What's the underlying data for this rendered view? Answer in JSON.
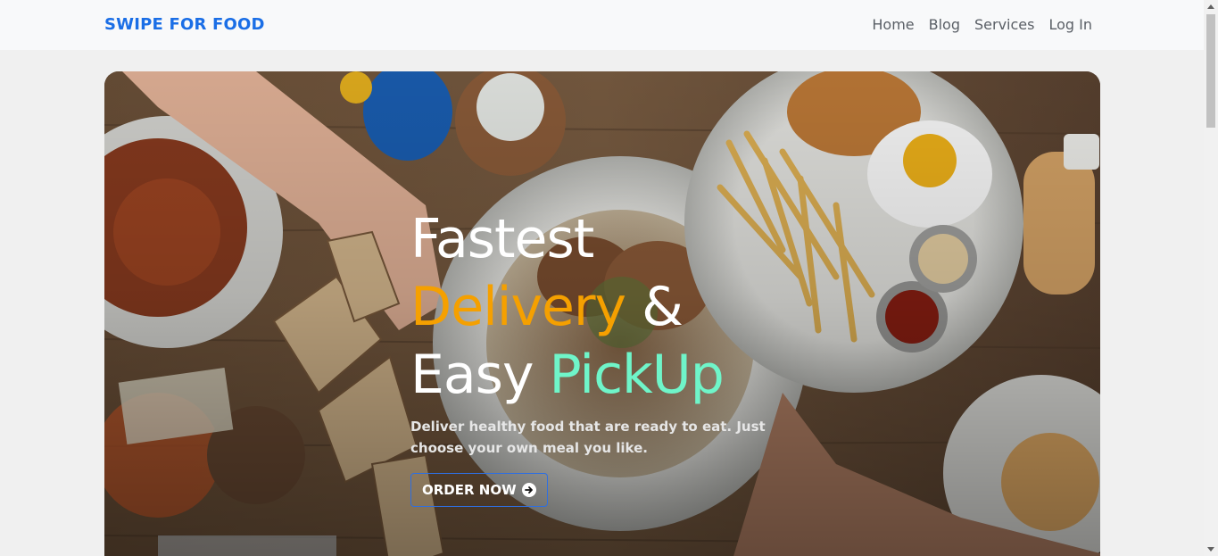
{
  "navbar": {
    "brand": "SWIPE FOR FOOD",
    "links": [
      "Home",
      "Blog",
      "Services",
      "Log In"
    ]
  },
  "hero": {
    "headline": {
      "line1": "Fastest",
      "line2_highlight": "Delivery",
      "line2_rest": " &",
      "line3_start": "Easy ",
      "line3_highlight": "PickUp"
    },
    "subtext": "Deliver healthy food that are ready to eat. Just choose your own meal you like.",
    "cta_label": "ORDER NOW"
  },
  "colors": {
    "brand": "#1a6ee6",
    "highlight_orange": "#f5a000",
    "highlight_mint": "#6ff5c9",
    "button_border": "#2f6fe0"
  },
  "icons": {
    "cta_icon": "arrow-right-circle-icon"
  }
}
